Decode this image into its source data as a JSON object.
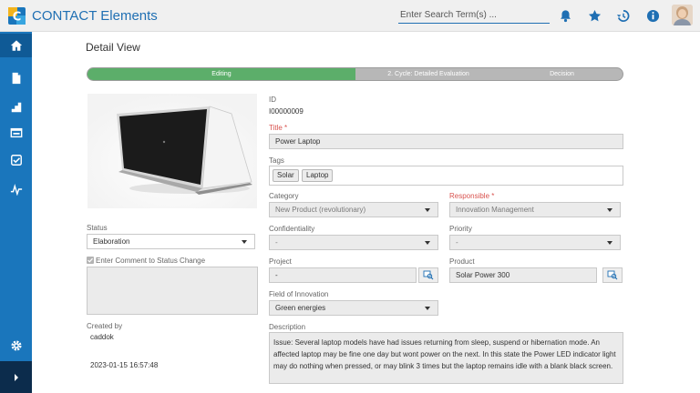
{
  "header": {
    "app_title": "CONTACT Elements",
    "search_placeholder": "Enter Search Term(s) ...",
    "icons": [
      "bell-icon",
      "star-icon",
      "history-icon",
      "info-icon"
    ]
  },
  "sidebar": {
    "items": [
      "home-icon",
      "document-icon",
      "stairs-icon",
      "card-icon",
      "checklist-icon",
      "analytics-icon"
    ],
    "bottom_items": [
      "settings-icon",
      "expand-icon"
    ]
  },
  "page": {
    "title": "Detail View"
  },
  "workflow": {
    "steps": [
      "Editing",
      "2. Cycle: Detailed Evaluation",
      "Decision"
    ],
    "active_step": 0
  },
  "left_panel": {
    "status_label": "Status",
    "status_value": "Elaboration",
    "comment_label": "Enter Comment to Status Change",
    "created_by_label": "Created by",
    "created_by_value": "caddok",
    "created_at": "2023-01-15 16:57:48"
  },
  "form": {
    "id_label": "ID",
    "id_value": "I00000009",
    "title_label": "Title *",
    "title_value": "Power Laptop",
    "tags_label": "Tags",
    "tags": [
      "Solar",
      "Laptop"
    ],
    "category_label": "Category",
    "category_value": "New Product (revolutionary)",
    "responsible_label": "Responsible *",
    "responsible_value": "Innovation Management",
    "confidentiality_label": "Confidentiality",
    "confidentiality_value": "-",
    "priority_label": "Priority",
    "priority_value": "-",
    "project_label": "Project",
    "project_value": "-",
    "product_label": "Product",
    "product_value": "Solar Power 300",
    "field_label": "Field of Innovation",
    "field_value": "Green energies",
    "description_label": "Description",
    "description_value": "Issue: Several laptop models have had issues returning from sleep, suspend or hibernation mode. An affected laptop may be fine one day but wont power on the next. In this state the Power LED indicator light may do nothing when pressed, or may blink 3 times but the laptop remains idle with a blank black screen."
  },
  "colors": {
    "brand_blue": "#1a76bc",
    "sidebar_dark": "#0c2c4c",
    "progress_green": "#5cae6a",
    "required_red": "#d9534f"
  }
}
